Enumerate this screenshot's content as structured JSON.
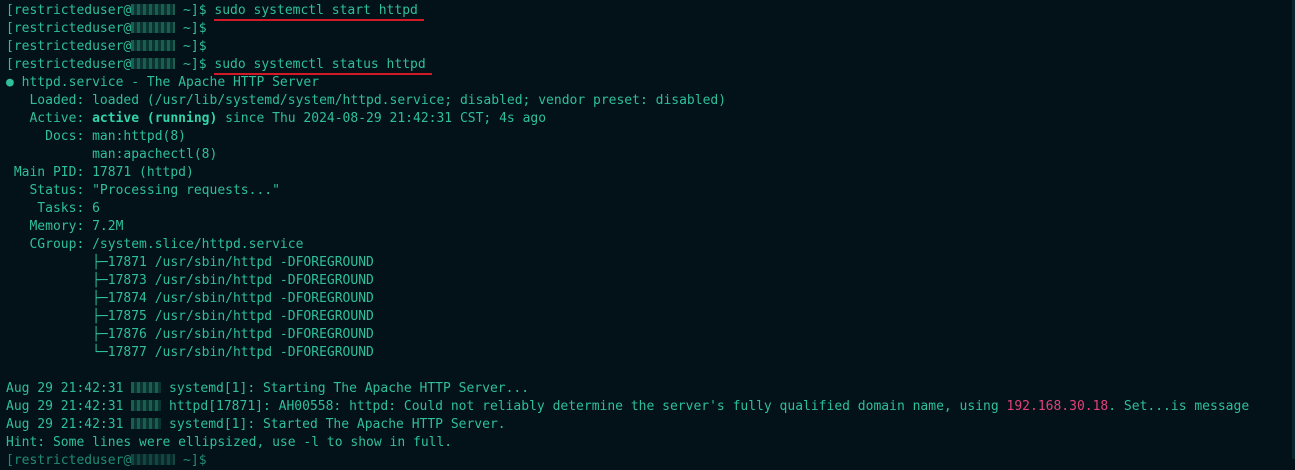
{
  "terminal": {
    "prompt": {
      "user": "[restricteduser@",
      "tail": " ~]$ "
    },
    "commands": {
      "start": "sudo systemctl start httpd",
      "status": "sudo systemctl status httpd"
    },
    "status": {
      "bullet": "●",
      "unit_line": " httpd.service - The Apache HTTP Server",
      "loaded": "   Loaded: loaded (/usr/lib/systemd/system/httpd.service; disabled; vendor preset: disabled)",
      "active_prefix": "   Active: ",
      "active_state": "active (running)",
      "active_suffix": " since Thu 2024-08-29 21:42:31 CST; 4s ago",
      "docs_1": "     Docs: man:httpd(8)",
      "docs_2": "           man:apachectl(8)",
      "main_pid": " Main PID: 17871 (httpd)",
      "status_text": "   Status: \"Processing requests...\"",
      "tasks": "    Tasks: 6",
      "memory": "   Memory: 7.2M",
      "cgroup": "   CGroup: /system.slice/httpd.service",
      "processes": [
        "           ├─17871 /usr/sbin/httpd -DFOREGROUND",
        "           ├─17873 /usr/sbin/httpd -DFOREGROUND",
        "           ├─17874 /usr/sbin/httpd -DFOREGROUND",
        "           ├─17875 /usr/sbin/httpd -DFOREGROUND",
        "           ├─17876 /usr/sbin/httpd -DFOREGROUND",
        "           └─17877 /usr/sbin/httpd -DFOREGROUND"
      ]
    },
    "logs": {
      "l1_time": "Aug 29 21:42:31 ",
      "l1_msg": " systemd[1]: Starting The Apache HTTP Server...",
      "l2_time": "Aug 29 21:42:31 ",
      "l2_msg": " httpd[17871]: AH00558: httpd: Could not reliably determine the server's fully qualified domain name, using ",
      "l2_ip": "192.168.30.18",
      "l2_tail": ". Set...is message",
      "l3_time": "Aug 29 21:42:31 ",
      "l3_msg": " systemd[1]: Started The Apache HTTP Server.",
      "hint": "Hint: Some lines were ellipsized, use -l to show in full."
    }
  }
}
